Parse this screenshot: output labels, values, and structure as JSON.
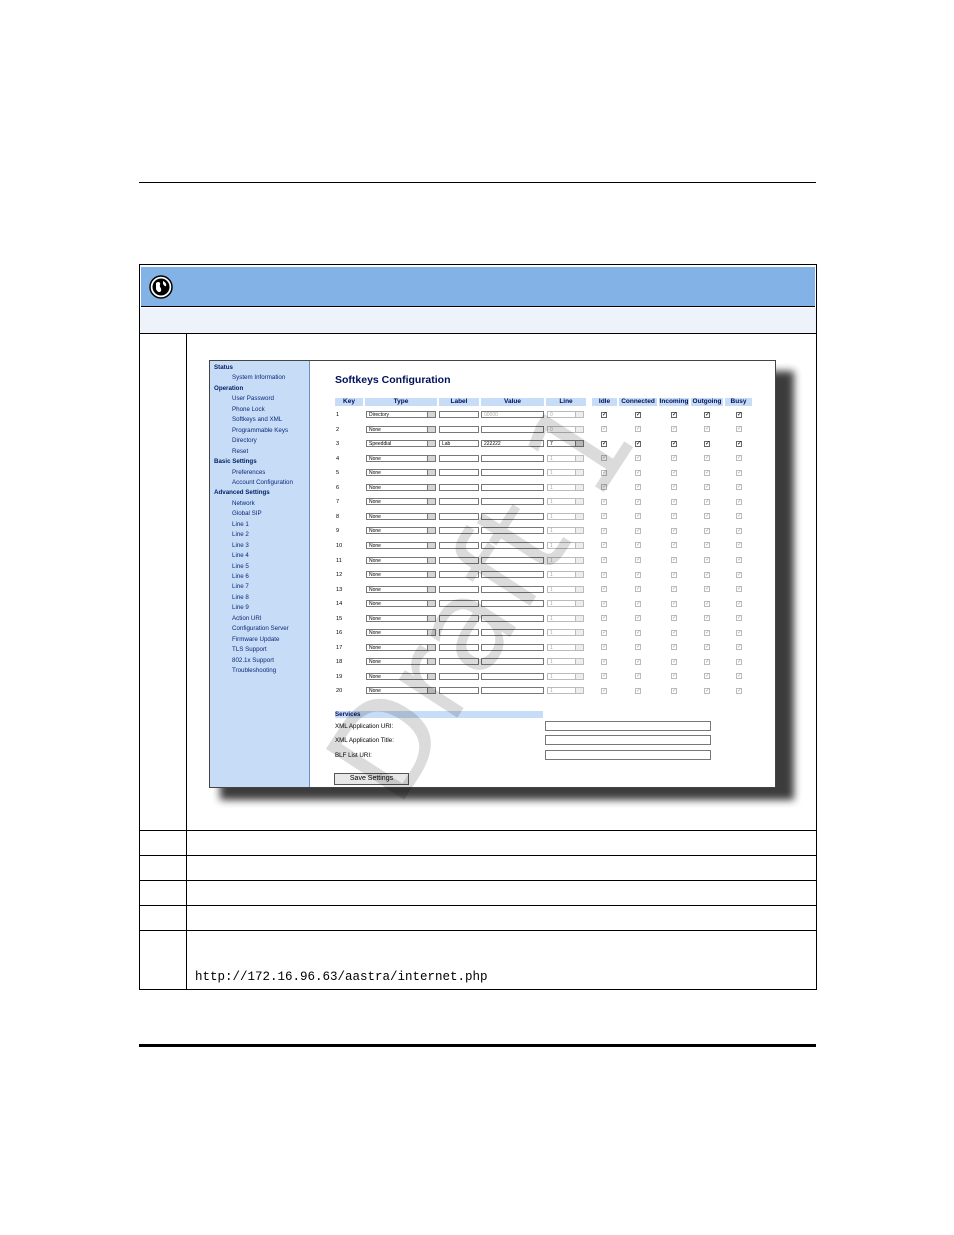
{
  "screenshot": {
    "nav": [
      {
        "label": "Status",
        "type": "section"
      },
      {
        "label": "System Information",
        "type": "item"
      },
      {
        "label": "Operation",
        "type": "section"
      },
      {
        "label": "User Password",
        "type": "item"
      },
      {
        "label": "Phone Lock",
        "type": "item"
      },
      {
        "label": "Softkeys and XML",
        "type": "item"
      },
      {
        "label": "Programmable Keys",
        "type": "item"
      },
      {
        "label": "Directory",
        "type": "item"
      },
      {
        "label": "Reset",
        "type": "item"
      },
      {
        "label": "Basic Settings",
        "type": "section"
      },
      {
        "label": "Preferences",
        "type": "item"
      },
      {
        "label": "Account Configuration",
        "type": "item"
      },
      {
        "label": "Advanced Settings",
        "type": "section"
      },
      {
        "label": "Network",
        "type": "item"
      },
      {
        "label": "Global SIP",
        "type": "item"
      },
      {
        "label": "Line 1",
        "type": "item"
      },
      {
        "label": "Line 2",
        "type": "item"
      },
      {
        "label": "Line 3",
        "type": "item"
      },
      {
        "label": "Line 4",
        "type": "item"
      },
      {
        "label": "Line 5",
        "type": "item"
      },
      {
        "label": "Line 6",
        "type": "item"
      },
      {
        "label": "Line 7",
        "type": "item"
      },
      {
        "label": "Line 8",
        "type": "item"
      },
      {
        "label": "Line 9",
        "type": "item"
      },
      {
        "label": "Action URI",
        "type": "item"
      },
      {
        "label": "Configuration Server",
        "type": "item"
      },
      {
        "label": "Firmware Update",
        "type": "item"
      },
      {
        "label": "TLS Support",
        "type": "item"
      },
      {
        "label": "802.1x Support",
        "type": "item"
      },
      {
        "label": "Troubleshooting",
        "type": "item"
      }
    ],
    "title": "Softkeys Configuration",
    "columns": {
      "key": "Key",
      "type": "Type",
      "label": "Label",
      "value": "Value",
      "line": "Line",
      "idle": "Idle",
      "connected": "Connected",
      "incoming": "Incoming",
      "outgoing": "Outgoing",
      "busy": "Busy"
    },
    "rows": [
      {
        "key": "1",
        "type": "Directory",
        "label": "",
        "value": "00000",
        "line": "0",
        "enabled": true
      },
      {
        "key": "2",
        "type": "None",
        "label": "",
        "value": "",
        "line": "0",
        "enabled": false
      },
      {
        "key": "3",
        "type": "Speeddial",
        "label": "Lab",
        "value": "222222",
        "line": "7",
        "enabled": true
      },
      {
        "key": "4",
        "type": "None",
        "label": "",
        "value": "",
        "line": "1",
        "enabled": false
      },
      {
        "key": "5",
        "type": "None",
        "label": "",
        "value": "",
        "line": "1",
        "enabled": false
      },
      {
        "key": "6",
        "type": "None",
        "label": "",
        "value": "",
        "line": "1",
        "enabled": false
      },
      {
        "key": "7",
        "type": "None",
        "label": "",
        "value": "",
        "line": "1",
        "enabled": false
      },
      {
        "key": "8",
        "type": "None",
        "label": "",
        "value": "",
        "line": "1",
        "enabled": false
      },
      {
        "key": "9",
        "type": "None",
        "label": "",
        "value": "",
        "line": "1",
        "enabled": false
      },
      {
        "key": "10",
        "type": "None",
        "label": "",
        "value": "",
        "line": "1",
        "enabled": false
      },
      {
        "key": "11",
        "type": "None",
        "label": "",
        "value": "",
        "line": "1",
        "enabled": false
      },
      {
        "key": "12",
        "type": "None",
        "label": "",
        "value": "",
        "line": "1",
        "enabled": false
      },
      {
        "key": "13",
        "type": "None",
        "label": "",
        "value": "",
        "line": "1",
        "enabled": false
      },
      {
        "key": "14",
        "type": "None",
        "label": "",
        "value": "",
        "line": "1",
        "enabled": false
      },
      {
        "key": "15",
        "type": "None",
        "label": "",
        "value": "",
        "line": "1",
        "enabled": false
      },
      {
        "key": "16",
        "type": "None",
        "label": "",
        "value": "",
        "line": "1",
        "enabled": false
      },
      {
        "key": "17",
        "type": "None",
        "label": "",
        "value": "",
        "line": "1",
        "enabled": false
      },
      {
        "key": "18",
        "type": "None",
        "label": "",
        "value": "",
        "line": "1",
        "enabled": false
      },
      {
        "key": "19",
        "type": "None",
        "label": "",
        "value": "",
        "line": "1",
        "enabled": false
      },
      {
        "key": "20",
        "type": "None",
        "label": "",
        "value": "",
        "line": "1",
        "enabled": false
      }
    ],
    "services": {
      "heading": "Services",
      "fields": [
        {
          "label": "XML Application URI:",
          "value": ""
        },
        {
          "label": "XML Application Title:",
          "value": ""
        },
        {
          "label": "BLF List URI:",
          "value": ""
        }
      ],
      "save_label": "Save Settings"
    }
  },
  "document": {
    "url": "http://172.16.96.63/aastra/internet.php",
    "watermark": "Draft 1"
  },
  "colors": {
    "header_band": "#83b3e6",
    "nav_bg": "#c7dcf6",
    "link": "#0a2a7a"
  }
}
